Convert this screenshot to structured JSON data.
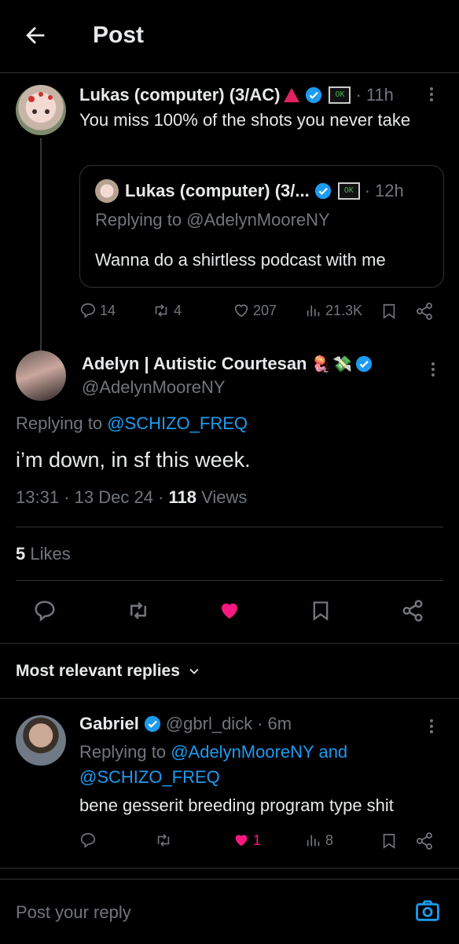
{
  "header": {
    "title": "Post"
  },
  "parent_post": {
    "author_name": "Lukas (computer) (3/AC)",
    "time": "11h",
    "text": "You miss 100% of the shots you never take",
    "quote": {
      "author_name": "Lukas (computer) (3/...",
      "time": "12h",
      "replying_prefix": "Replying to",
      "replying_handle": "@AdelynMooreNY",
      "text": "Wanna do a shirtless podcast with me"
    },
    "actions": {
      "replies": "14",
      "reposts": "4",
      "likes": "207",
      "views": "21.3K"
    }
  },
  "main_post": {
    "author_name": "Adelyn | Autistic Courtesan",
    "handle": "@AdelynMooreNY",
    "replying_prefix": "Replying to",
    "replying_handle": "@SCHIZO_FREQ",
    "text": "i’m down, in sf this week.",
    "time": "13:31",
    "date": "13 Dec 24",
    "views_count": "118",
    "views_label": "Views",
    "likes_count": "5",
    "likes_label": "Likes"
  },
  "replies_section": {
    "sort_label": "Most relevant replies"
  },
  "reply": {
    "author_name": "Gabriel",
    "handle": "@gbrl_dick",
    "time": "6m",
    "replying_prefix": "Replying to",
    "replying_handle_1": "@AdelynMooreNY",
    "replying_and": "and",
    "replying_handle_2": "@SCHIZO_FREQ",
    "text": "bene gesserit breeding program type shit",
    "actions": {
      "likes": "1",
      "views": "8"
    }
  },
  "composer": {
    "placeholder": "Post your reply"
  },
  "colors": {
    "accent": "#1d9bf0",
    "like": "#f91880",
    "muted": "#71767b",
    "divider": "#2f3336"
  }
}
